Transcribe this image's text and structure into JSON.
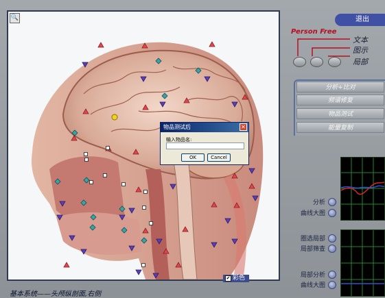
{
  "header": {
    "exit_label": "退出",
    "brand": "Person Free"
  },
  "legend": {
    "text_label": "文本",
    "diagram_label": "图示",
    "local_label": "局部"
  },
  "menu": {
    "items": [
      "分析+比对",
      "频谱修复",
      "物品测试",
      "能量复制"
    ]
  },
  "panel1": {
    "labels": [
      "分析",
      "曲线大图"
    ]
  },
  "panel2": {
    "labels": [
      "圈选局部",
      "局部筛查"
    ]
  },
  "panel3": {
    "labels": [
      "局部分析",
      "曲线大图"
    ]
  },
  "viewer": {
    "color_toggle_label": "彩色",
    "color_toggle_mark": "✔",
    "zoom_icon": "magnifier-icon",
    "zoom_glyph": "🔍"
  },
  "status": {
    "caption": "基本系统——头颅纵剖面,右侧"
  },
  "dialog": {
    "title": "物品测试后",
    "close_glyph": "✕",
    "prompt": "输入物品名:",
    "input_value": "",
    "ok_label": "OK",
    "cancel_label": "Cancel"
  },
  "colors": {
    "accent": "#4050a4",
    "brand": "#b70f1f",
    "scope_grid": "#1f8a35",
    "frame": "#2f3a52"
  }
}
